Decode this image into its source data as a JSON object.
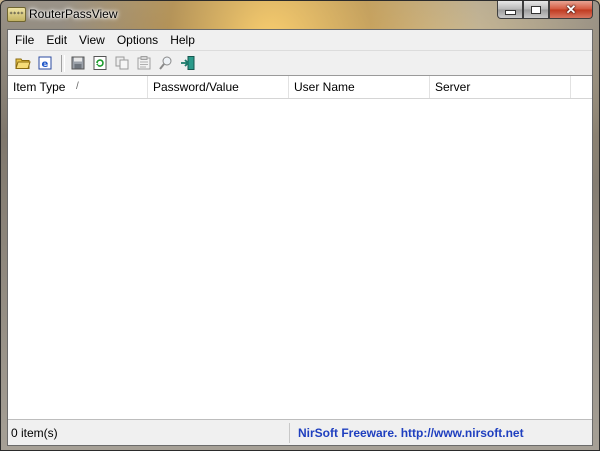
{
  "window": {
    "title": "RouterPassView",
    "icon": "app-icon",
    "buttons": [
      "minimize",
      "maximize",
      "close"
    ]
  },
  "menu": {
    "items": [
      "File",
      "Edit",
      "View",
      "Options",
      "Help"
    ]
  },
  "toolbar": {
    "buttons": [
      {
        "icon": "open-folder-icon"
      },
      {
        "icon": "internet-explorer-icon"
      },
      {
        "icon": "save-icon"
      },
      {
        "icon": "refresh-icon"
      },
      {
        "icon": "copy-icon"
      },
      {
        "icon": "properties-icon"
      },
      {
        "icon": "find-icon"
      },
      {
        "icon": "exit-icon"
      }
    ]
  },
  "list": {
    "columns": [
      "Item Type",
      "Password/Value",
      "User Name",
      "Server"
    ],
    "sort_indicator": "/",
    "rows": []
  },
  "status": {
    "count": "0 item(s)",
    "link": "NirSoft Freeware.  http://www.nirsoft.net"
  },
  "colors": {
    "link": "#1f3fbf",
    "close_button": "#c0391f"
  }
}
